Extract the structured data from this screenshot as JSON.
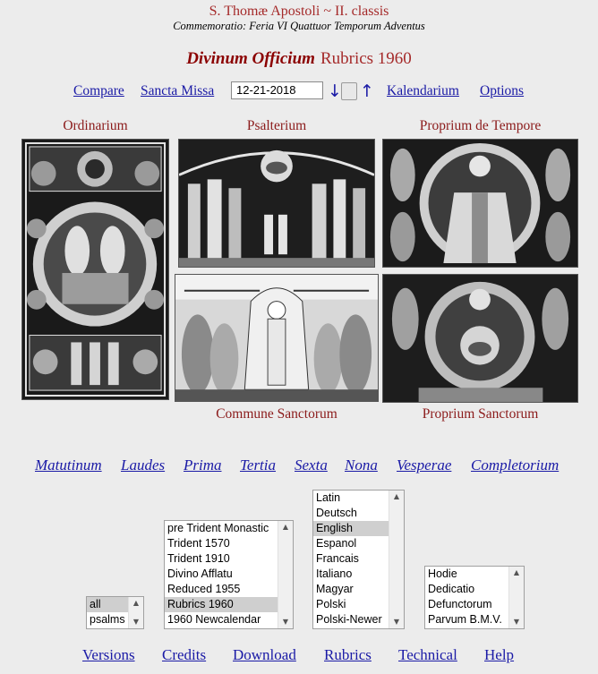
{
  "header": {
    "title": "S. Thomæ Apostoli ~ II. classis",
    "commemoratio": "Commemoratio: Feria VI Quattuor Temporum Adventus"
  },
  "officium": {
    "main": "Divinum Officium",
    "rubrics": "Rubrics 1960"
  },
  "toolbar": {
    "compare": "Compare",
    "sancta_missa": "Sancta Missa",
    "date": "12-21-2018",
    "down_arrow": "↓",
    "up_arrow": "↑",
    "kalendarium": "Kalendarium",
    "options": "Options"
  },
  "sections": {
    "ordinarium": "Ordinarium",
    "psalterium": "Psalterium",
    "proprium_tempore": "Proprium de Tempore",
    "commune": "Commune Sanctorum",
    "proprium_sanctorum": "Proprium Sanctorum"
  },
  "hours": [
    "Matutinum",
    "Laudes",
    "Prima",
    "Tertia",
    "Sexta",
    "Nona",
    "Vesperae",
    "Completorium"
  ],
  "scope_select": {
    "options": [
      "all",
      "psalms"
    ],
    "selected": "all"
  },
  "version_select": {
    "options": [
      "pre Trident Monastic",
      "Trident 1570",
      "Trident 1910",
      "Divino Afflatu",
      "Reduced 1955",
      "Rubrics 1960",
      "1960 Newcalendar"
    ],
    "selected": "Rubrics 1960"
  },
  "language_select": {
    "options": [
      "Latin",
      "Deutsch",
      "English",
      "Espanol",
      "Francais",
      "Italiano",
      "Magyar",
      "Polski",
      "Polski-Newer"
    ],
    "selected": "English"
  },
  "votive_select": {
    "options": [
      "Hodie",
      "Dedicatio",
      "Defunctorum",
      "Parvum B.M.V."
    ]
  },
  "footer": [
    "Versions",
    "Credits",
    "Download",
    "Rubrics",
    "Technical",
    "Help"
  ],
  "colors": {
    "link": "#1a1aa6",
    "heading": "#8b1a1a",
    "background": "#ececec"
  }
}
